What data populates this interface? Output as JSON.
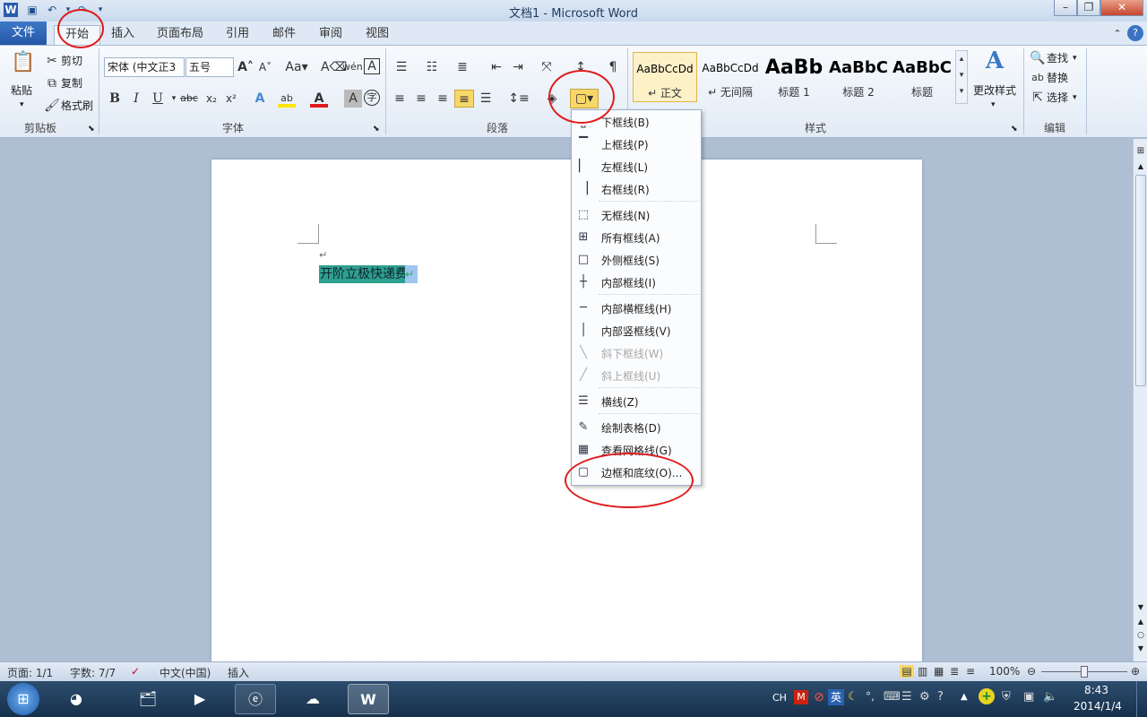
{
  "window": {
    "title": "文档1 - Microsoft Word"
  },
  "tabs": [
    {
      "label": "文件"
    },
    {
      "label": "开始"
    },
    {
      "label": "插入"
    },
    {
      "label": "页面布局"
    },
    {
      "label": "引用"
    },
    {
      "label": "邮件"
    },
    {
      "label": "审阅"
    },
    {
      "label": "视图"
    }
  ],
  "clipboard": {
    "paste": "粘贴",
    "cut": "剪切",
    "copy": "复制",
    "format_painter": "格式刷",
    "group": "剪贴板"
  },
  "font": {
    "family": "宋体 (中文正3",
    "size": "五号",
    "group": "字体"
  },
  "paragraph": {
    "group": "段落"
  },
  "styles": {
    "group": "样式",
    "tiles": [
      {
        "sample": "AaBbCcDd",
        "cap": "↵ 正文"
      },
      {
        "sample": "AaBbCcDd",
        "cap": "↵ 无间隔"
      },
      {
        "sample": "AaBb",
        "cap": "标题 1"
      },
      {
        "sample": "AaBbC",
        "cap": "标题 2"
      },
      {
        "sample": "AaBbC",
        "cap": "标题"
      }
    ],
    "change": "更改样式"
  },
  "editing": {
    "find": "查找",
    "replace": "替换",
    "select": "选择",
    "group": "编辑"
  },
  "document": {
    "selected_text": "开阶立极快递费",
    "return_mark": "↵"
  },
  "border_menu": {
    "items": [
      {
        "label": "下框线(B)",
        "icon": "border-bottom-icon"
      },
      {
        "label": "上框线(P)",
        "icon": "border-top-icon"
      },
      {
        "label": "左框线(L)",
        "icon": "border-left-icon"
      },
      {
        "label": "右框线(R)",
        "icon": "border-right-icon"
      },
      {
        "label": "无框线(N)",
        "icon": "border-none-icon"
      },
      {
        "label": "所有框线(A)",
        "icon": "border-all-icon"
      },
      {
        "label": "外侧框线(S)",
        "icon": "border-outside-icon"
      },
      {
        "label": "内部框线(I)",
        "icon": "border-inside-icon"
      },
      {
        "label": "内部横框线(H)",
        "icon": "border-inside-h-icon"
      },
      {
        "label": "内部竖框线(V)",
        "icon": "border-inside-v-icon"
      },
      {
        "label": "斜下框线(W)",
        "icon": "diag-down-icon"
      },
      {
        "label": "斜上框线(U)",
        "icon": "diag-up-icon"
      },
      {
        "label": "横线(Z)",
        "icon": "horizontal-line-icon"
      },
      {
        "label": "绘制表格(D)",
        "icon": "draw-table-icon"
      },
      {
        "label": "查看网格线(G)",
        "icon": "gridlines-icon"
      },
      {
        "label": "边框和底纹(O)...",
        "icon": "borders-shading-icon"
      }
    ]
  },
  "statusbar": {
    "page": "页面: 1/1",
    "words": "字数: 7/7",
    "lang": "中文(中国)",
    "mode": "插入",
    "zoom": "100%"
  },
  "taskbar": {
    "time": "8:43",
    "date": "2014/1/4",
    "ime": "英",
    "ch": "CH"
  }
}
